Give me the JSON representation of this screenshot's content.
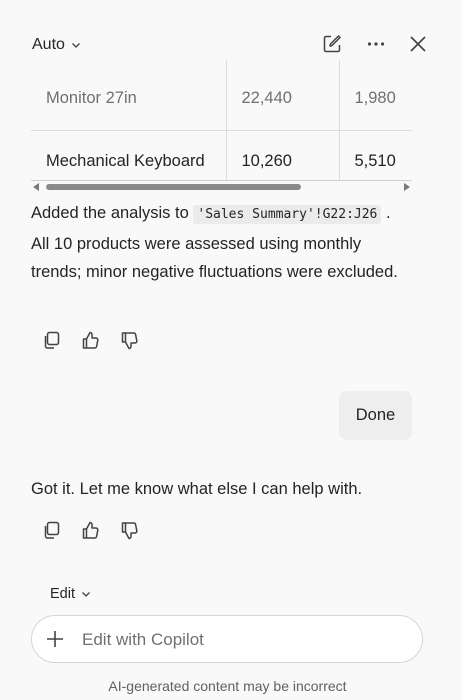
{
  "header": {
    "mode_label": "Auto",
    "icons": [
      "chevron-down-icon",
      "new-chat-icon",
      "more-icon",
      "close-icon"
    ]
  },
  "table": {
    "rows": [
      [
        "Monitor 27in",
        "22,440",
        "1,980"
      ],
      [
        "Mechanical Keyboard",
        "10,260",
        "5,510"
      ]
    ]
  },
  "assistant_message_1": {
    "prefix": "Added the analysis to",
    "code": "'Sales Summary'!G22:J26",
    "suffix": ". All 10 products were assessed using monthly trends; minor negative fluctuations were excluded."
  },
  "user_message": "Done",
  "assistant_message_2": "Got it. Let me know what else I can help with.",
  "composer": {
    "mode_label": "Edit",
    "placeholder": "Edit with Copilot"
  },
  "disclaimer": "AI-generated content may be incorrect"
}
